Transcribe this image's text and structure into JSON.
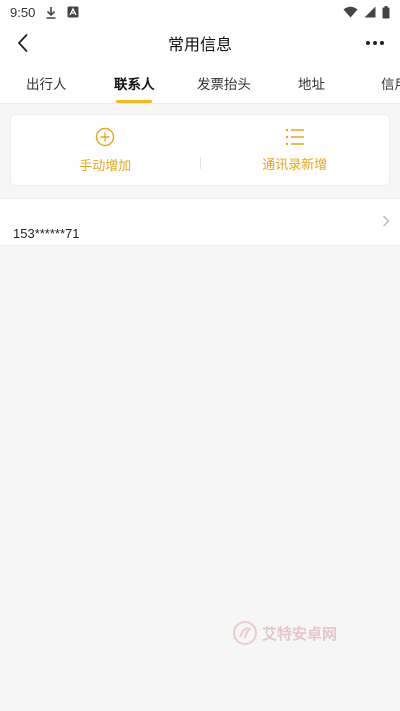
{
  "status_bar": {
    "time": "9:50"
  },
  "header": {
    "title": "常用信息"
  },
  "tabs": [
    {
      "label": "出行人",
      "active": false
    },
    {
      "label": "联系人",
      "active": true
    },
    {
      "label": "发票抬头",
      "active": false
    },
    {
      "label": "地址",
      "active": false
    },
    {
      "label": "信用",
      "active": false
    }
  ],
  "actions": {
    "manual_add": "手动增加",
    "contacts_add": "通讯录新增"
  },
  "contacts": [
    {
      "phone": "153******71"
    }
  ],
  "watermark": {
    "text": "艾特安卓网"
  },
  "colors": {
    "accent": "#f5b81d",
    "action_text": "#e6a817",
    "background": "#f6f6f6"
  },
  "icons": {
    "back": "chevron-left-icon",
    "more": "more-dots-icon",
    "manual_add": "plus-circle-icon",
    "contacts_add": "list-icon",
    "row_arrow": "chevron-right-icon"
  }
}
